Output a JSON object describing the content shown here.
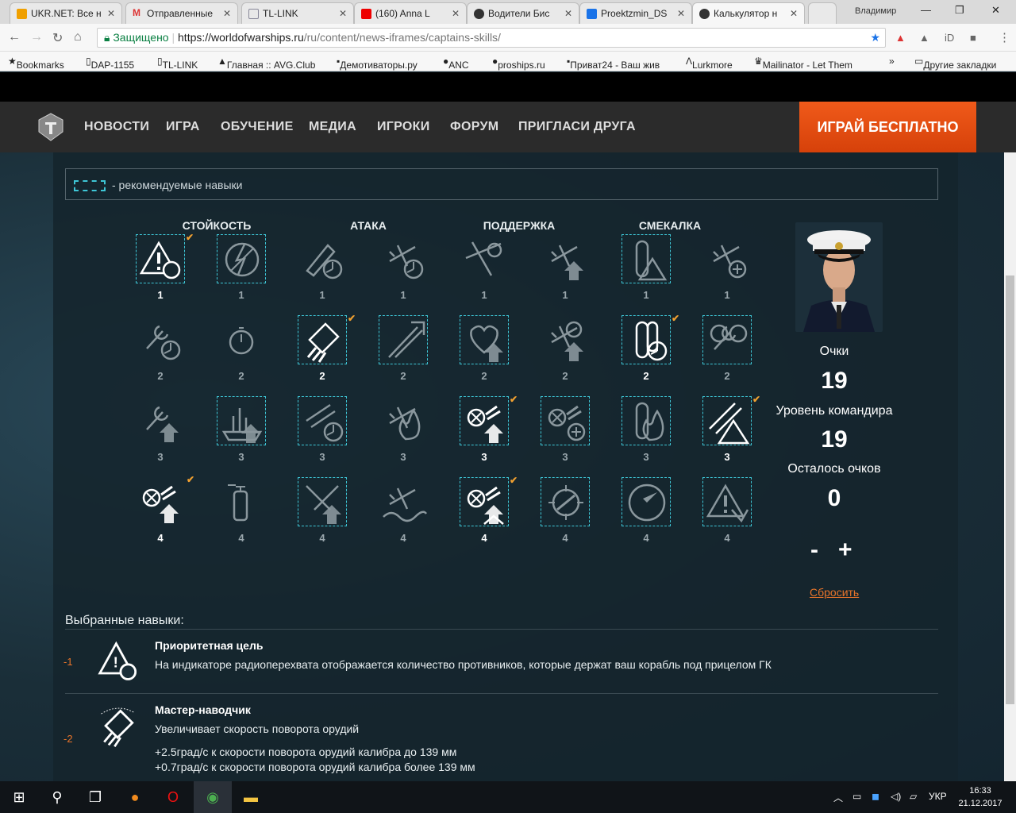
{
  "browser": {
    "tabs": [
      {
        "label": "UKR.NET: Все н",
        "icon": "ukrnet-icon",
        "color": "#f0a000"
      },
      {
        "label": "Отправленные",
        "icon": "gmail-icon",
        "color": "#d33"
      },
      {
        "label": "TL-LINK",
        "icon": "page-icon",
        "color": "#aac"
      },
      {
        "label": "(160) Anna L",
        "icon": "youtube-icon",
        "color": "#e00"
      },
      {
        "label": "Водители Бис",
        "icon": "wows-icon",
        "color": "#333"
      },
      {
        "label": "Proektzmin_DS",
        "icon": "doc-icon",
        "color": "#1a73e8"
      },
      {
        "label": "Калькулятор н",
        "icon": "wows-icon",
        "color": "#333"
      }
    ],
    "user": "Владимир",
    "secure_label": "Защищено",
    "url_host": "https://worldofwarships.ru",
    "url_path": "/ru/content/news-iframes/captains-skills/",
    "bookmarks": [
      "Bookmarks",
      "DAP-1155",
      "TL-LINK",
      "Главная :: AVG.Club",
      "Демотиваторы.ру",
      "ANC",
      "proships.ru",
      "Приват24 - Ваш жив",
      "Lurkmore",
      "Mailinator - Let Them",
      "»",
      "Другие закладки"
    ]
  },
  "site": {
    "nav": [
      "НОВОСТИ",
      "ИГРА",
      "ОБУЧЕНИЕ",
      "МЕДИА",
      "ИГРОКИ",
      "ФОРУМ",
      "ПРИГЛАСИ ДРУГА"
    ],
    "play_button": "ИГРАЙ БЕСПЛАТНО"
  },
  "calc": {
    "legend": "- рекомендуемые навыки",
    "categories": [
      "СТОЙКОСТЬ",
      "АТАКА",
      "ПОДДЕРЖКА",
      "СМЕКАЛКА"
    ],
    "rows": [
      {
        "cost": "1",
        "skills": [
          {
            "icon": "warning-target-icon",
            "rec": true,
            "sel": true
          },
          {
            "icon": "lightning-shield-icon",
            "rec": true,
            "sel": false
          },
          {
            "icon": "shell-gauge-icon",
            "rec": false,
            "sel": false
          },
          {
            "icon": "plane-gauge-icon",
            "rec": false,
            "sel": false
          },
          {
            "icon": "plane-target-icon",
            "rec": false,
            "sel": false
          },
          {
            "icon": "plane-upgrade-icon",
            "rec": false,
            "sel": false
          },
          {
            "icon": "torpedo-warning-icon",
            "rec": true,
            "sel": false
          },
          {
            "icon": "plane-repair-icon",
            "rec": false,
            "sel": false
          }
        ]
      },
      {
        "cost": "2",
        "skills": [
          {
            "icon": "wrench-gauge-icon",
            "rec": false,
            "sel": false
          },
          {
            "icon": "stopwatch-icon",
            "rec": false,
            "sel": false
          },
          {
            "icon": "turret-rotate-icon",
            "rec": true,
            "sel": true
          },
          {
            "icon": "shell-up-icon",
            "rec": true,
            "sel": false
          },
          {
            "icon": "hp-up-icon",
            "rec": true,
            "sel": false
          },
          {
            "icon": "fighter-up-icon",
            "rec": false,
            "sel": false
          },
          {
            "icon": "torpedo-gauge-icon",
            "rec": true,
            "sel": true
          },
          {
            "icon": "repair-wheel-icon",
            "rec": true,
            "sel": false
          }
        ]
      },
      {
        "cost": "3",
        "skills": [
          {
            "icon": "wrench-up-icon",
            "rec": false,
            "sel": false
          },
          {
            "icon": "ship-up-icon",
            "rec": true,
            "sel": false
          },
          {
            "icon": "torpedo-reload-icon",
            "rec": true,
            "sel": false
          },
          {
            "icon": "plane-fire-icon",
            "rec": false,
            "sel": false
          },
          {
            "icon": "aa-up-icon",
            "rec": true,
            "sel": true
          },
          {
            "icon": "aa-heal-icon",
            "rec": true,
            "sel": false
          },
          {
            "icon": "shell-fire-icon",
            "rec": true,
            "sel": false
          },
          {
            "icon": "torpedo-alert-icon",
            "rec": true,
            "sel": true
          }
        ]
      },
      {
        "cost": "4",
        "skills": [
          {
            "icon": "aa-guns-up-icon",
            "rec": false,
            "sel": true
          },
          {
            "icon": "extinguisher-icon",
            "rec": false,
            "sel": false
          },
          {
            "icon": "torpedo-cross-icon",
            "rec": true,
            "sel": false
          },
          {
            "icon": "planes-wave-icon",
            "rec": false,
            "sel": false
          },
          {
            "icon": "aa-double-up-icon",
            "rec": true,
            "sel": true
          },
          {
            "icon": "radar-target-icon",
            "rec": true,
            "sel": false
          },
          {
            "icon": "radar-sweep-icon",
            "rec": true,
            "sel": false
          },
          {
            "icon": "warning-down-icon",
            "rec": true,
            "sel": false
          }
        ]
      }
    ],
    "points_label": "Очки",
    "points_value": "19",
    "level_label": "Уровень командира",
    "level_value": "19",
    "left_label": "Осталось очков",
    "left_value": "0",
    "minus": "-",
    "plus": "+",
    "reset": "Сбросить"
  },
  "selected": {
    "title": "Выбранные навыки:",
    "items": [
      {
        "num": "-1",
        "name": "Приоритетная цель",
        "desc": "На индикаторе радиоперехвата отображается количество противников, которые держат ваш корабль под прицелом ГК",
        "extra": []
      },
      {
        "num": "-2",
        "name": "Мастер-наводчик",
        "desc": "Увеличивает скорость поворота орудий",
        "extra": [
          "+2.5град/с к скорости поворота орудий калибра до 139 мм",
          "+0.7град/с к скорости поворота орудий калибра более 139 мм"
        ]
      }
    ]
  },
  "taskbar": {
    "lang": "УКР",
    "time": "16:33",
    "date": "21.12.2017"
  }
}
